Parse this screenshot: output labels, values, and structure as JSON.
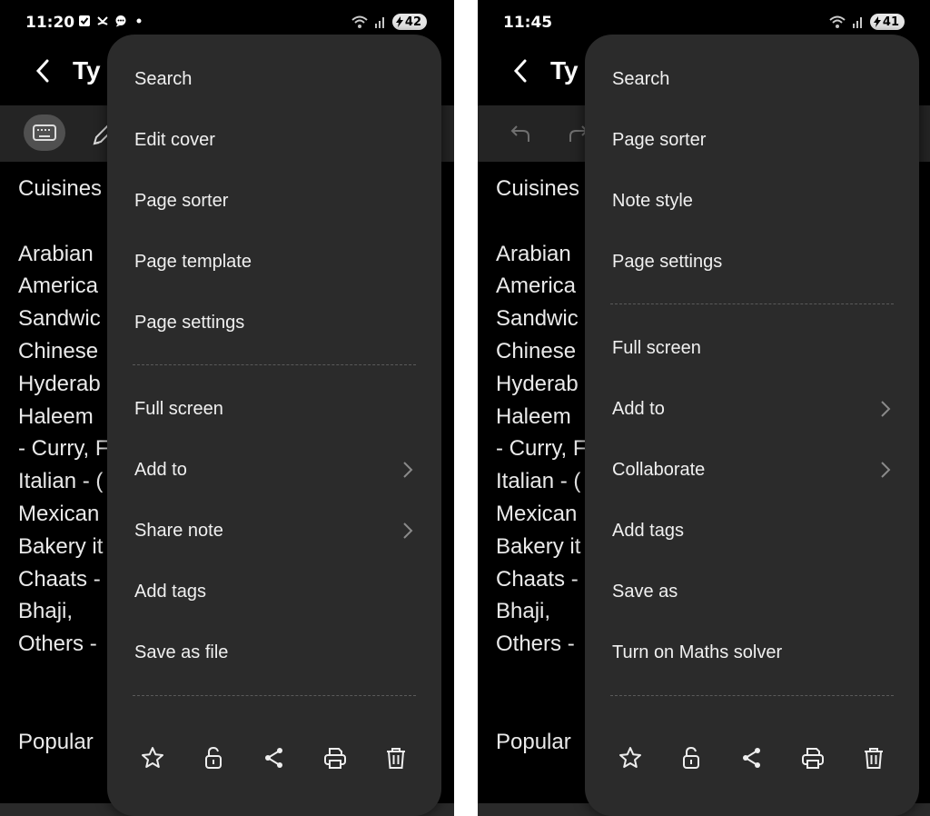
{
  "left": {
    "status_time": "11:20",
    "battery": "42",
    "title": "Ty",
    "note_lines": [
      "Cuisines",
      "",
      "Arabian",
      "America",
      "Sandwic",
      "Chinese",
      "Hyderab",
      "Haleem",
      "- Curry, F",
      "Italian - (",
      "Mexican",
      "Bakery it",
      "Chaats -",
      "Bhaji,",
      "Others -",
      "",
      "",
      "Popular"
    ],
    "menu": {
      "search": "Search",
      "edit_cover": "Edit cover",
      "page_sorter": "Page sorter",
      "page_template": "Page template",
      "page_settings": "Page settings",
      "full_screen": "Full screen",
      "add_to": "Add to",
      "share_note": "Share note",
      "add_tags": "Add tags",
      "save_as_file": "Save as file"
    }
  },
  "right": {
    "status_time": "11:45",
    "battery": "41",
    "title": "Ty",
    "note_lines": [
      "Cuisines",
      "",
      "Arabian",
      "America",
      "Sandwic",
      "Chinese",
      "Hyderab",
      "Haleem",
      "- Curry, F",
      "Italian - (",
      "Mexican",
      "Bakery it",
      "Chaats -",
      "Bhaji,",
      "Others -",
      "",
      "",
      "Popular"
    ],
    "menu": {
      "search": "Search",
      "page_sorter": "Page sorter",
      "note_style": "Note style",
      "page_settings": "Page settings",
      "full_screen": "Full screen",
      "add_to": "Add to",
      "collaborate": "Collaborate",
      "add_tags": "Add tags",
      "save_as": "Save as",
      "maths_solver": "Turn on Maths solver"
    }
  },
  "icons": {
    "actions": [
      "star-icon",
      "unlock-icon",
      "share-icon",
      "print-icon",
      "trash-icon"
    ]
  },
  "colors": {
    "menu_bg": "#2b2b2b",
    "text": "#f0f0f0",
    "toolbar": "#242424"
  }
}
